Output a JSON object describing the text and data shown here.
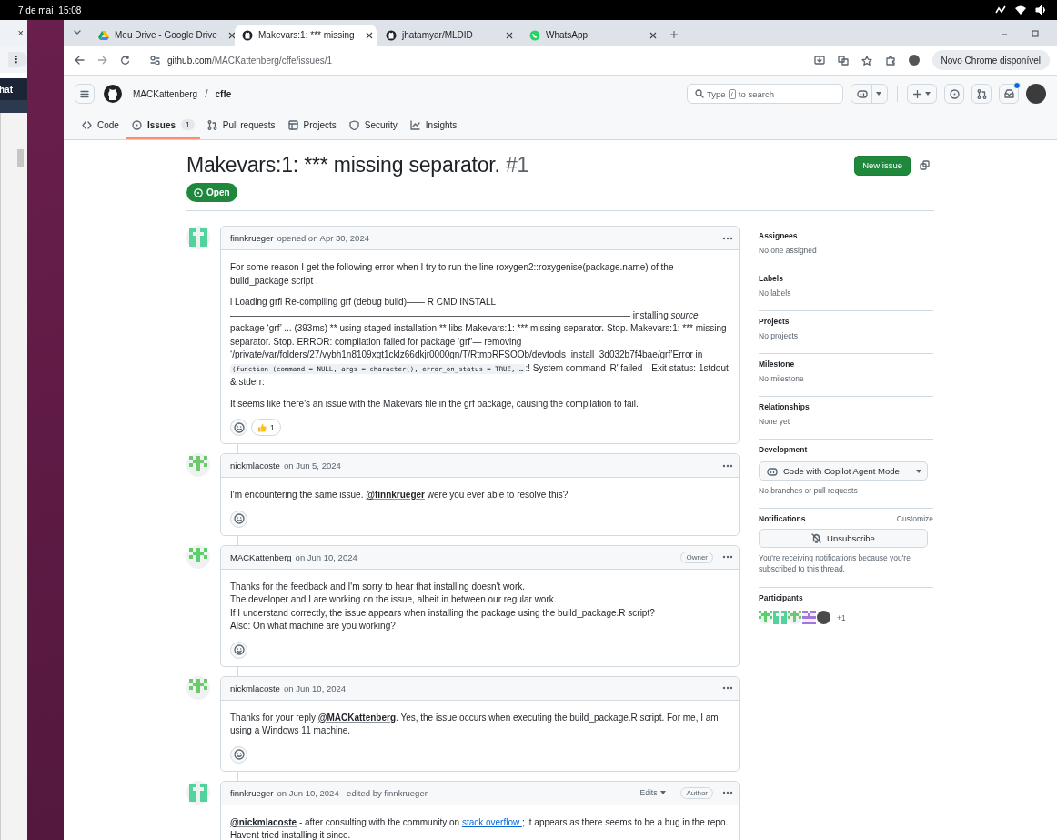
{
  "system_bar": {
    "date": "7 de mai",
    "time": "15:08"
  },
  "background_window": {
    "close": "×",
    "menu": "⋮",
    "title": "hat"
  },
  "browser": {
    "tabs": [
      {
        "title": "Meu Drive - Google Drive",
        "selected": false
      },
      {
        "title": "Makevars:1: *** missing",
        "selected": true
      },
      {
        "title": "jhatamyar/MLDID",
        "selected": false
      },
      {
        "title": "WhatsApp",
        "selected": false
      }
    ],
    "url_host": "github.com",
    "url_path": "/MACKattenberg/cffe/issues/1",
    "update_button": "Novo Chrome disponível"
  },
  "repo_header": {
    "owner": "MACKattenberg",
    "separator": "/",
    "name": "cffe",
    "search_prefix": "Type",
    "search_key": "/",
    "search_suffix": "to search",
    "nav_tabs": [
      {
        "label": "Code",
        "selected": false
      },
      {
        "label": "Issues",
        "count": "1",
        "selected": true
      },
      {
        "label": "Pull requests",
        "selected": false
      },
      {
        "label": "Projects",
        "selected": false
      },
      {
        "label": "Security",
        "selected": false
      },
      {
        "label": "Insights",
        "selected": false
      }
    ]
  },
  "issue": {
    "title": "Makevars:1: *** missing separator.",
    "number": "#1",
    "state": "Open",
    "new_issue": "New issue"
  },
  "comments": [
    {
      "author": "finnkrueger",
      "color": "#52d39b",
      "meta": "opened on Apr 30, 2024",
      "paragraphs": [
        [
          {
            "kind": "text",
            "text": "For some reason I get the following error when I try to run the line roxygen2::roxygenise(package.name) of the build_package script ."
          }
        ],
        [
          {
            "kind": "text",
            "text": "i Loading grfi Re-compiling grf (debug build)—— R CMD INSTALL ———————————————————————————————————————————— installing "
          },
          {
            "kind": "italic",
            "text": "source"
          },
          {
            "kind": "text",
            "text": " package ‘grf’ ... (393ms) ** using staged installation ** libs Makevars:1: *** missing separator. Stop. Makevars:1: *** missing separator. Stop. ERROR: compilation failed for package ‘grf’— removing ‘/private/var/folders/27/vybh1n8109xgt1cklz66dkjr0000gn/T/RtmpRFSOOb/devtools_install_3d032b7f4bae/grf’Error in "
          },
          {
            "kind": "code",
            "text": "(function (command = NULL, args = character(), error_on_status = TRUE, …"
          },
          {
            "kind": "text",
            "text": ":! System command 'R' failed---Exit status: 1stdout & stderr:"
          }
        ],
        [
          {
            "kind": "text",
            "text": "It seems like there's an issue with the Makevars file in the grf package, causing the compilation to fail."
          }
        ]
      ],
      "reactions": [
        {
          "count": "1"
        }
      ]
    },
    {
      "author": "nickmlacoste",
      "color": "#6cc96c",
      "meta": "on Jun 5, 2024",
      "paragraphs": [
        [
          {
            "kind": "text",
            "text": "I'm encountering the same issue. "
          },
          {
            "kind": "mention",
            "text": "@finnkrueger"
          },
          {
            "kind": "text",
            "text": " were you ever able to resolve this?"
          }
        ]
      ]
    },
    {
      "author": "MACKattenberg",
      "color": "#5ccf6a",
      "meta": "on Jun 10, 2024",
      "badge": "Owner",
      "paragraphs": [
        [
          {
            "kind": "text",
            "text": "Thanks for the feedback and I'm sorry to hear that installing doesn't work."
          },
          {
            "kind": "break"
          },
          {
            "kind": "text",
            "text": "The developer and I are working on the issue, albeit in between our regular work."
          },
          {
            "kind": "break"
          },
          {
            "kind": "text",
            "text": "If I understand correctly, the issue appears when installing the package using the build_package.R script?"
          },
          {
            "kind": "break"
          },
          {
            "kind": "text",
            "text": "Also: On what machine are you working?"
          }
        ]
      ]
    },
    {
      "author": "nickmlacoste",
      "color": "#6cc96c",
      "meta": "on Jun 10, 2024",
      "paragraphs": [
        [
          {
            "kind": "text",
            "text": "Thanks for your reply "
          },
          {
            "kind": "mention",
            "text": "@MACKattenberg"
          },
          {
            "kind": "text",
            "text": ". Yes, the issue occurs when executing the build_package.R script. For me, I am using a Windows 11 machine."
          }
        ]
      ]
    },
    {
      "author": "finnkrueger",
      "color": "#52d39b",
      "meta": "on Jun 10, 2024 · edited by finnkrueger",
      "edits": "Edits",
      "badge": "Author",
      "paragraphs": [
        [
          {
            "kind": "mention",
            "text": "@nickmlacoste"
          },
          {
            "kind": "text",
            "text": " - after consulting with the community on "
          },
          {
            "kind": "link",
            "text": "stack overflow "
          },
          {
            "kind": "text",
            "text": "; it appears as there seems to be a bug in the repo. Havent tried installing it since."
          }
        ]
      ]
    }
  ],
  "sidebar": {
    "sections": [
      {
        "kind": "text",
        "heading": "Assignees",
        "value": "No one assigned"
      },
      {
        "kind": "text",
        "heading": "Labels",
        "value": "No labels"
      },
      {
        "kind": "text",
        "heading": "Projects",
        "value": "No projects"
      },
      {
        "kind": "text",
        "heading": "Milestone",
        "value": "No milestone"
      },
      {
        "kind": "text",
        "heading": "Relationships",
        "value": "None yet"
      },
      {
        "kind": "development",
        "heading": "Development",
        "button": "Code with Copilot Agent Mode",
        "value": "No branches or pull requests"
      },
      {
        "kind": "notifications",
        "heading": "Notifications",
        "action": "Customize",
        "button": "Unsubscribe",
        "value": "You're receiving notifications because you're subscribed to this thread."
      },
      {
        "kind": "participants",
        "heading": "Participants",
        "participants": [
          {
            "kind": "identicon",
            "color": "#5ccf6a"
          },
          {
            "kind": "identicon",
            "color": "#52d39b"
          },
          {
            "kind": "identicon",
            "color": "#6cc96c"
          },
          {
            "kind": "identicon",
            "color": "#a474e0"
          },
          {
            "kind": "photo",
            "color": "#4a4a4a"
          }
        ],
        "more": "+1"
      }
    ]
  }
}
